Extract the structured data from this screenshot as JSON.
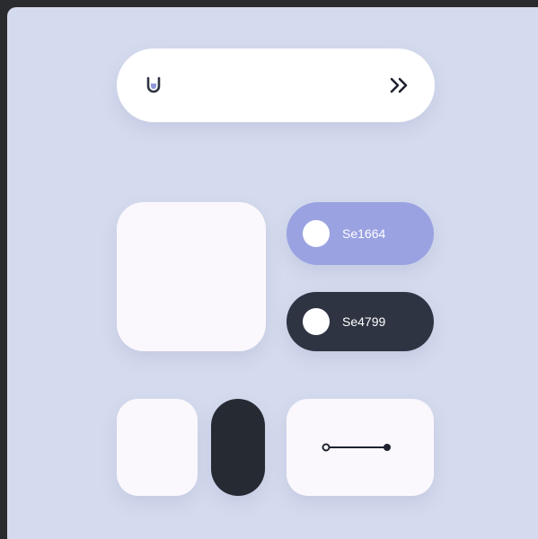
{
  "search_bar": {
    "logo_icon": "u-logo-icon",
    "action_icon": "double-chevron-right-icon"
  },
  "toggles": [
    {
      "label": "Se1664",
      "color": "#9aa2e2",
      "knob": "left"
    },
    {
      "label": "Se4799",
      "color": "#2e3442",
      "knob": "left"
    }
  ],
  "slider": {
    "icon": "line-slider-icon"
  },
  "colors": {
    "background": "#d5dbee",
    "card": "#fbf8fd",
    "accent_purple": "#9aa2e2",
    "dark": "#2e3442"
  }
}
